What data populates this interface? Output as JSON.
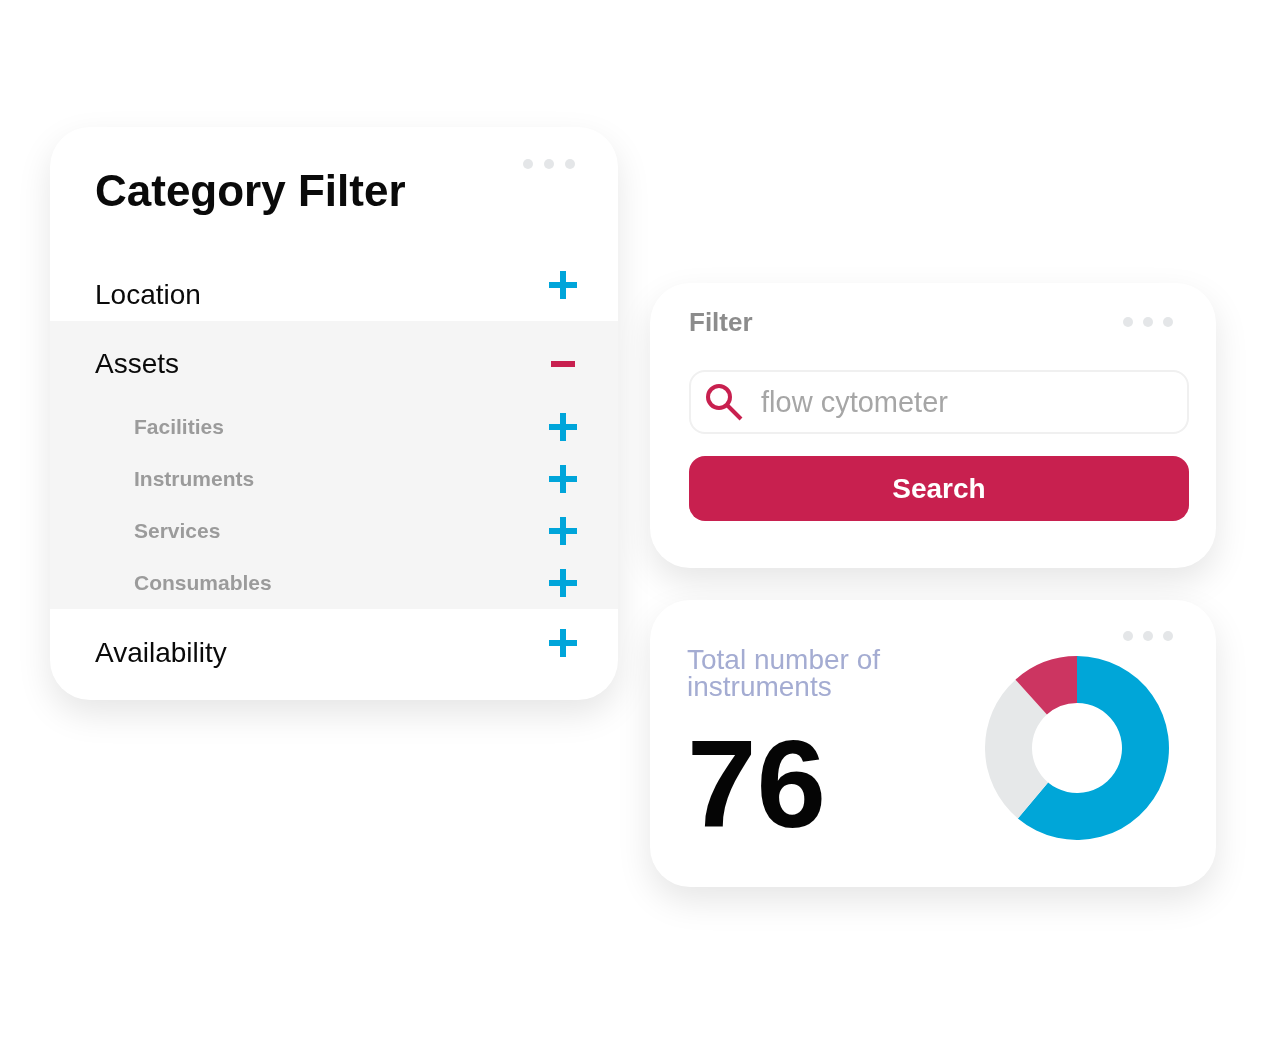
{
  "category_filter": {
    "title": "Category Filter",
    "categories": [
      {
        "label": "Location",
        "expanded": false
      },
      {
        "label": "Assets",
        "expanded": true,
        "children": [
          {
            "label": "Facilities",
            "expanded": false
          },
          {
            "label": "Instruments",
            "expanded": false
          },
          {
            "label": "Services",
            "expanded": false
          },
          {
            "label": "Consumables",
            "expanded": false
          }
        ]
      },
      {
        "label": "Availability",
        "expanded": false
      }
    ]
  },
  "filter": {
    "title": "Filter",
    "search": {
      "placeholder": "flow cytometer"
    },
    "button": "Search"
  },
  "instrument_total": {
    "label": "Total number of instruments",
    "value": "76"
  }
}
